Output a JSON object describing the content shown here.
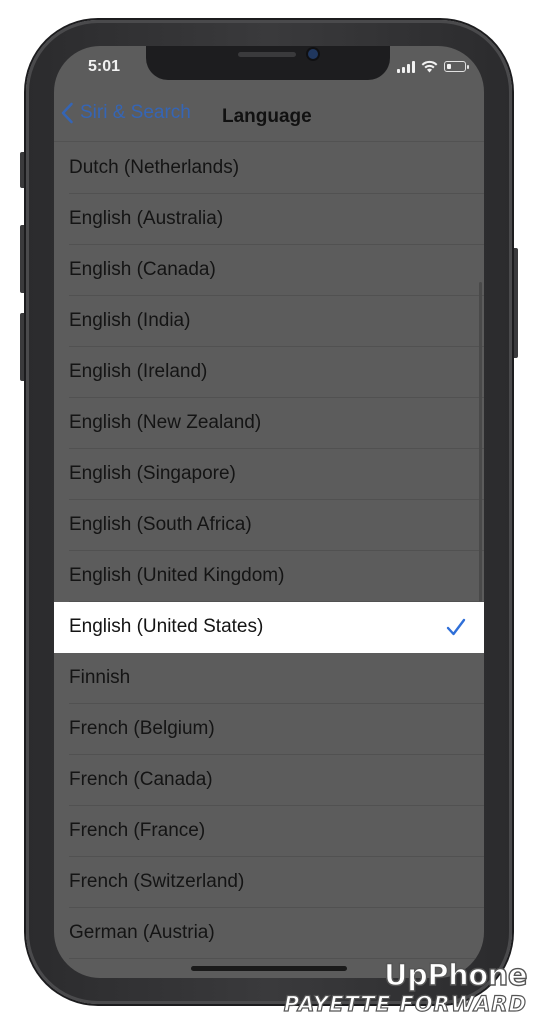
{
  "status_bar": {
    "time": "5:01",
    "battery_level": 0.25
  },
  "nav": {
    "back_label": "Siri & Search",
    "title": "Language"
  },
  "languages": [
    {
      "label": "Dutch (Netherlands)",
      "selected": false
    },
    {
      "label": "English (Australia)",
      "selected": false
    },
    {
      "label": "English (Canada)",
      "selected": false
    },
    {
      "label": "English (India)",
      "selected": false
    },
    {
      "label": "English (Ireland)",
      "selected": false
    },
    {
      "label": "English (New Zealand)",
      "selected": false
    },
    {
      "label": "English (Singapore)",
      "selected": false
    },
    {
      "label": "English (South Africa)",
      "selected": false
    },
    {
      "label": "English (United Kingdom)",
      "selected": false
    },
    {
      "label": "English (United States)",
      "selected": true
    },
    {
      "label": "Finnish",
      "selected": false
    },
    {
      "label": "French (Belgium)",
      "selected": false
    },
    {
      "label": "French (Canada)",
      "selected": false
    },
    {
      "label": "French (France)",
      "selected": false
    },
    {
      "label": "French (Switzerland)",
      "selected": false
    },
    {
      "label": "German (Austria)",
      "selected": false
    }
  ],
  "watermark": {
    "line1": "UpPhone",
    "line2": "PAYETTE FORWARD"
  },
  "colors": {
    "accent": "#3565b5",
    "checkmark": "#2f6fd8",
    "dimmed_background": "#5c5c5c",
    "selected_row": "#ffffff"
  },
  "icons": {
    "back": "chevron-left-icon",
    "selected": "checkmark-icon",
    "signal": "cellular-signal-icon",
    "wifi": "wifi-icon",
    "battery": "battery-icon"
  }
}
